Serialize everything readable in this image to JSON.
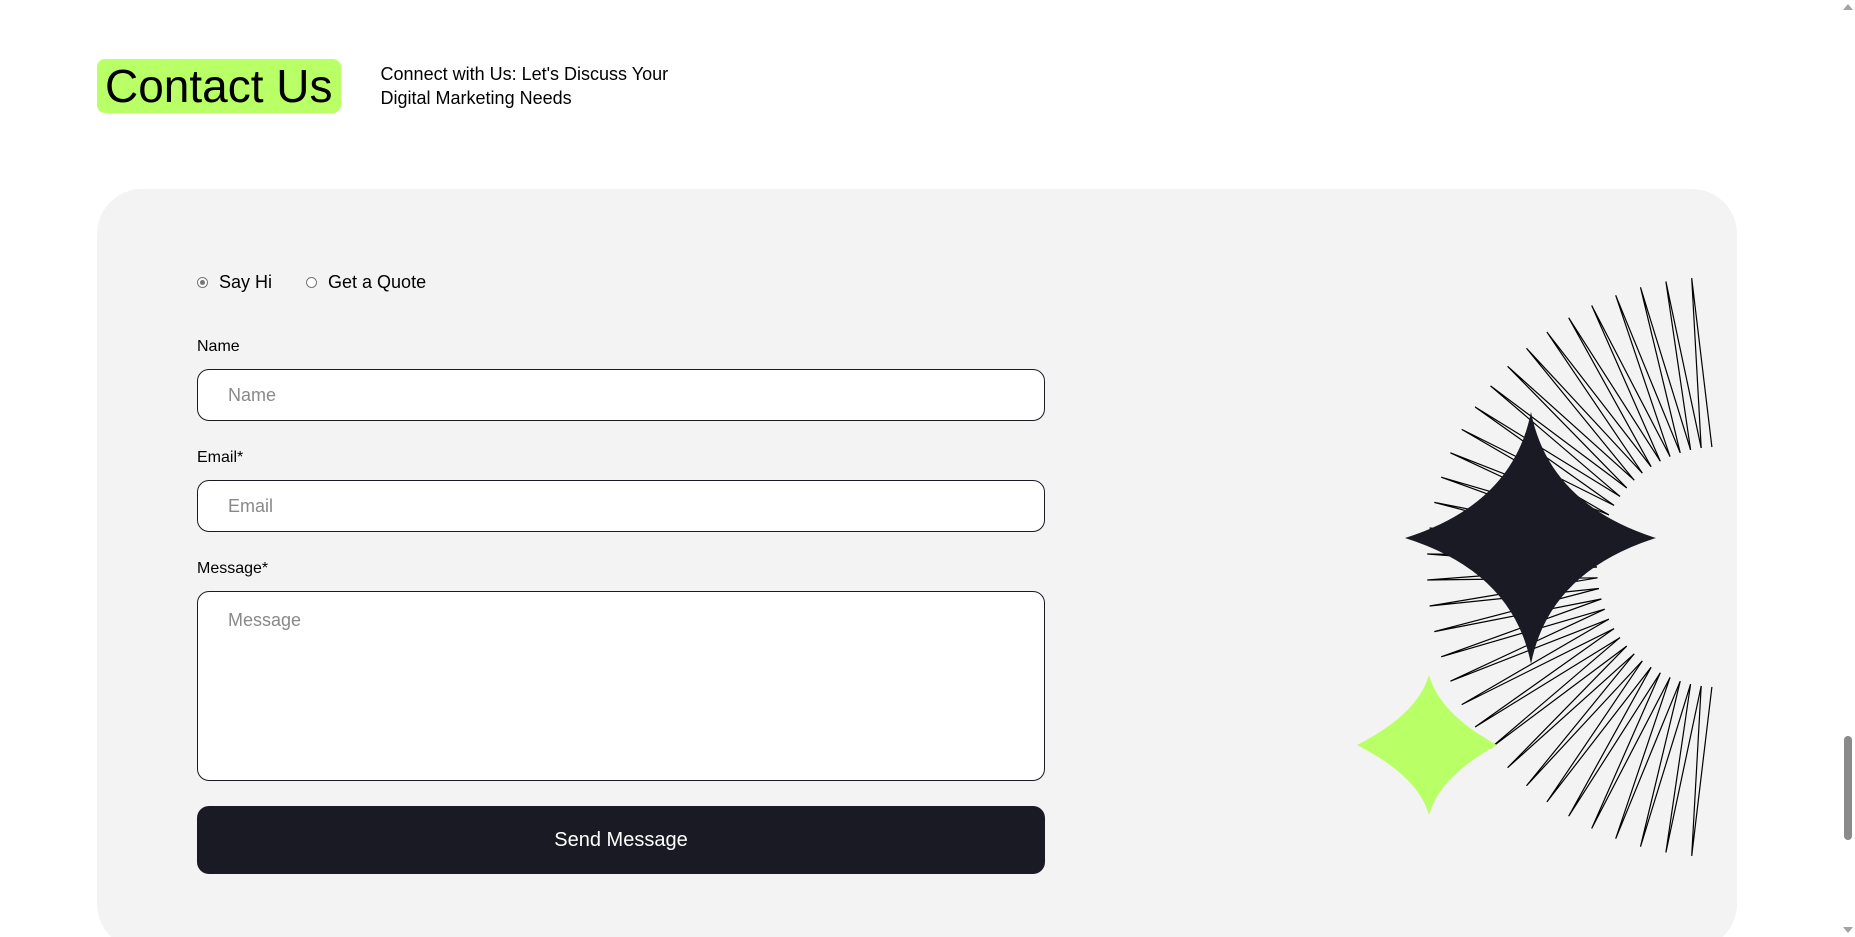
{
  "header": {
    "title": "Contact Us",
    "subtitle": "Connect with Us: Let's Discuss Your Digital Marketing Needs"
  },
  "form": {
    "radio_options": [
      {
        "label": "Say Hi",
        "checked": true
      },
      {
        "label": "Get a Quote",
        "checked": false
      }
    ],
    "name_label": "Name",
    "name_placeholder": "Name",
    "email_label": "Email*",
    "email_placeholder": "Email",
    "message_label": "Message*",
    "message_placeholder": "Message",
    "submit_label": "Send Message"
  },
  "colors": {
    "accent": "#B9FF66",
    "dark": "#191A23",
    "panel": "#F3F3F3"
  },
  "icons": [
    "dark-star-icon",
    "green-star-icon",
    "sunburst-lines"
  ]
}
